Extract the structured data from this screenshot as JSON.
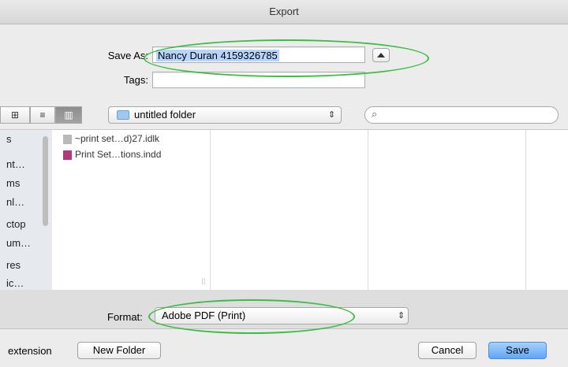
{
  "window": {
    "title": "Export"
  },
  "save_as": {
    "label": "Save As:",
    "value": "Nancy Duran 4159326785",
    "tags_label": "Tags:",
    "tags_value": ""
  },
  "toolbar": {
    "view_icon": "icon-view-icon",
    "view_list": "list-view-icon",
    "view_column": "column-view-icon",
    "location": "untitled folder",
    "search_placeholder": ""
  },
  "sidebar": {
    "items": [
      "s",
      "nt…",
      "ms",
      "nl…",
      "ctop",
      "um…",
      "res",
      "ic…"
    ]
  },
  "files": [
    {
      "name": "~print set…d)27.idlk",
      "icon": "idlk-file-icon"
    },
    {
      "name": "Print Set…tions.indd",
      "icon": "indd-file-icon"
    }
  ],
  "column_grip": "⁞⁞",
  "format": {
    "label": "Format:",
    "value": "Adobe PDF (Print)"
  },
  "footer": {
    "hide_ext_label": "extension",
    "new_folder": "New Folder",
    "cancel": "Cancel",
    "save": "Save"
  },
  "colors": {
    "annotation": "#3ebd46",
    "selection": "#b5d5ff",
    "save_button": "#5fa6f5"
  }
}
